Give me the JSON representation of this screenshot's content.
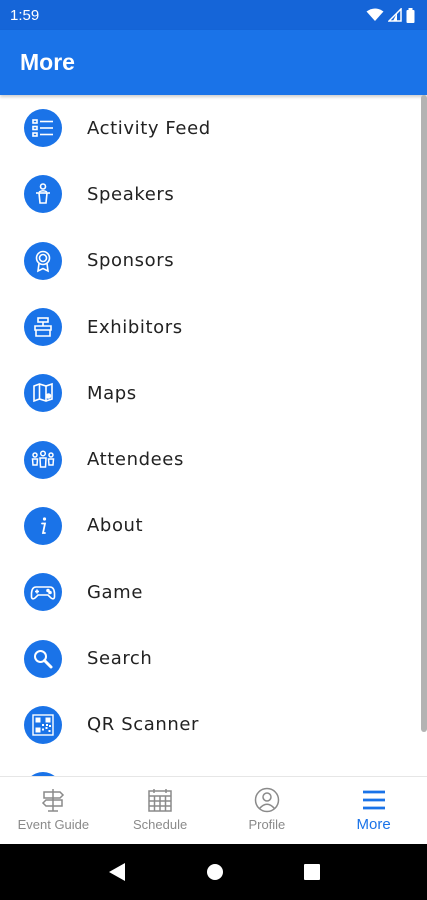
{
  "status_bar": {
    "time": "1:59"
  },
  "app_bar": {
    "title": "More"
  },
  "menu": [
    {
      "label": "Activity Feed",
      "icon": "list-icon"
    },
    {
      "label": "Speakers",
      "icon": "speaker-podium-icon"
    },
    {
      "label": "Sponsors",
      "icon": "award-ribbon-icon"
    },
    {
      "label": "Exhibitors",
      "icon": "exhibitor-booth-icon"
    },
    {
      "label": "Maps",
      "icon": "map-icon"
    },
    {
      "label": "Attendees",
      "icon": "people-icon"
    },
    {
      "label": "About",
      "icon": "info-icon"
    },
    {
      "label": "Game",
      "icon": "gamepad-icon"
    },
    {
      "label": "Search",
      "icon": "search-icon"
    },
    {
      "label": "QR Scanner",
      "icon": "qr-code-icon"
    }
  ],
  "bottom_nav": [
    {
      "label": "Event Guide",
      "icon": "signpost-icon",
      "active": false
    },
    {
      "label": "Schedule",
      "icon": "calendar-icon",
      "active": false
    },
    {
      "label": "Profile",
      "icon": "profile-icon",
      "active": false
    },
    {
      "label": "More",
      "icon": "hamburger-icon",
      "active": true
    }
  ],
  "colors": {
    "primary": "#1a73e8",
    "status_bar": "#1565d8",
    "inactive": "#8a8a8a"
  }
}
